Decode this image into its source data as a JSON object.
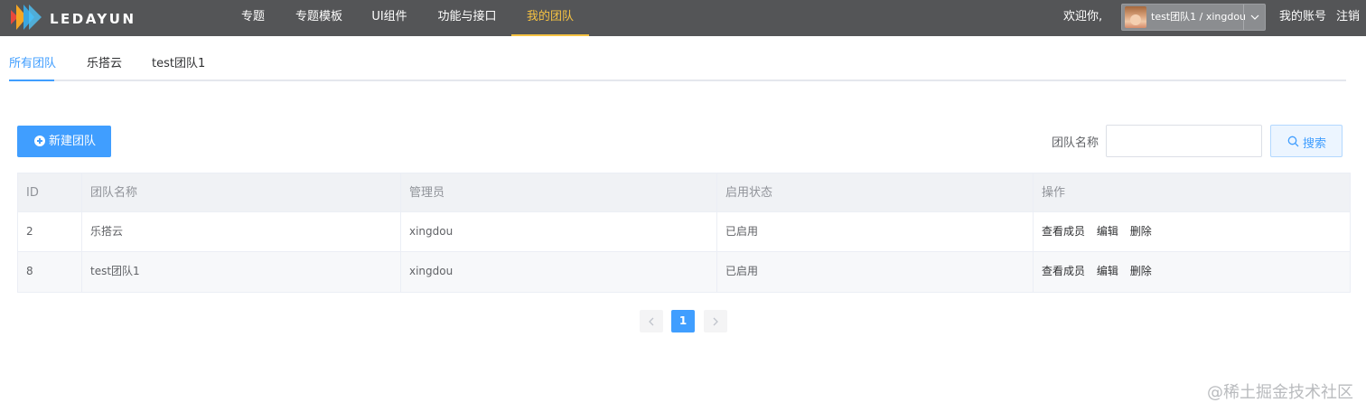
{
  "app": {
    "logo_text": "LEDAYUN",
    "accent_color": "#409eff",
    "active_nav_color": "#f5c242"
  },
  "nav": {
    "items": [
      "专题",
      "专题模板",
      "UI组件",
      "功能与接口",
      "我的团队"
    ],
    "active": "我的团队"
  },
  "header": {
    "welcome": "欢迎你,",
    "user": "test团队1 / xingdou",
    "account_link": "我的账号",
    "logout_link": "注销"
  },
  "tabs": {
    "items": [
      "所有团队",
      "乐搭云",
      "test团队1"
    ],
    "active": "所有团队"
  },
  "toolbar": {
    "new_button": "新建团队",
    "search_label": "团队名称",
    "search_value": "",
    "search_button": "搜索"
  },
  "table": {
    "columns": [
      "ID",
      "团队名称",
      "管理员",
      "启用状态",
      "操作"
    ],
    "rows": [
      {
        "id": "2",
        "name": "乐搭云",
        "admin": "xingdou",
        "status": "已启用"
      },
      {
        "id": "8",
        "name": "test团队1",
        "admin": "xingdou",
        "status": "已启用"
      }
    ],
    "actions": [
      "查看成员",
      "编辑",
      "删除"
    ]
  },
  "pagination": {
    "current_page": "1"
  },
  "watermark": "@稀土掘金技术社区"
}
